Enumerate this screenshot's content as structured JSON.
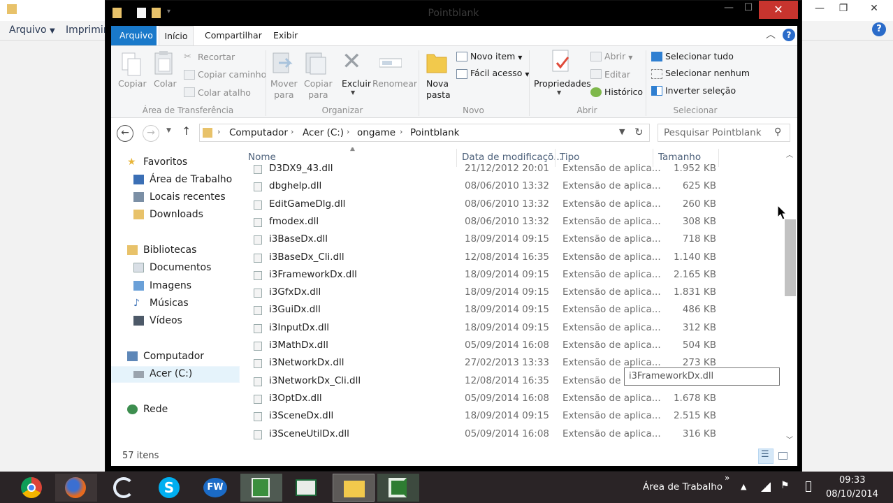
{
  "background_window": {
    "menu": [
      "Arquivo",
      "Imprimir"
    ],
    "controls": [
      "—",
      "❐",
      "✕"
    ]
  },
  "window": {
    "title": "Pointblank",
    "controls": {
      "minimize": "—",
      "maximize": "☐",
      "close": "✕"
    }
  },
  "ribbon_tabs": [
    "Arquivo",
    "Início",
    "Compartilhar",
    "Exibir"
  ],
  "ribbon": {
    "clipboard": {
      "copy": "Copiar",
      "paste": "Colar",
      "cut": "Recortar",
      "copy_path": "Copiar caminho",
      "paste_shortcut": "Colar atalho",
      "group_label": "Área de Transferência"
    },
    "organize": {
      "move_to": [
        "Mover",
        "para"
      ],
      "copy_to": [
        "Copiar",
        "para"
      ],
      "delete": "Excluir",
      "rename": "Renomear",
      "group_label": "Organizar"
    },
    "new": {
      "new_folder": [
        "Nova",
        "pasta"
      ],
      "new_item": "Novo item",
      "easy_access": "Fácil acesso",
      "group_label": "Novo"
    },
    "open": {
      "properties": "Propriedades",
      "open": "Abrir",
      "edit": "Editar",
      "history": "Histórico",
      "group_label": "Abrir"
    },
    "select": {
      "select_all": "Selecionar tudo",
      "select_none": "Selecionar nenhum",
      "invert": "Inverter seleção",
      "group_label": "Selecionar"
    }
  },
  "breadcrumb": [
    "Computador",
    "Acer (C:)",
    "ongame",
    "Pointblank"
  ],
  "search": {
    "placeholder": "Pesquisar Pointblank"
  },
  "nav": {
    "favorites": "Favoritos",
    "desktop": "Área de Trabalho",
    "recent": "Locais recentes",
    "downloads": "Downloads",
    "libraries": "Bibliotecas",
    "documents": "Documentos",
    "images": "Imagens",
    "music": "Músicas",
    "videos": "Vídeos",
    "computer": "Computador",
    "drive": "Acer (C:)",
    "network": "Rede"
  },
  "columns": {
    "name": "Nome",
    "date": "Data de modificaçõ...",
    "type": "Tipo",
    "size": "Tamanho"
  },
  "files": [
    {
      "name": "D3DX9_43.dll",
      "date": "21/12/2012 20:01",
      "type": "Extensão de aplica...",
      "size": "1.952 KB"
    },
    {
      "name": "dbghelp.dll",
      "date": "08/06/2010 13:32",
      "type": "Extensão de aplica...",
      "size": "625 KB"
    },
    {
      "name": "EditGameDlg.dll",
      "date": "08/06/2010 13:32",
      "type": "Extensão de aplica...",
      "size": "260 KB"
    },
    {
      "name": "fmodex.dll",
      "date": "08/06/2010 13:32",
      "type": "Extensão de aplica...",
      "size": "308 KB"
    },
    {
      "name": "i3BaseDx.dll",
      "date": "18/09/2014 09:15",
      "type": "Extensão de aplica...",
      "size": "718 KB"
    },
    {
      "name": "i3BaseDx_Cli.dll",
      "date": "12/08/2014 16:35",
      "type": "Extensão de aplica...",
      "size": "1.140 KB"
    },
    {
      "name": "i3FrameworkDx.dll",
      "date": "18/09/2014 09:15",
      "type": "Extensão de aplica...",
      "size": "2.165 KB"
    },
    {
      "name": "i3GfxDx.dll",
      "date": "18/09/2014 09:15",
      "type": "Extensão de aplica...",
      "size": "1.831 KB"
    },
    {
      "name": "i3GuiDx.dll",
      "date": "18/09/2014 09:15",
      "type": "Extensão de aplica...",
      "size": "486 KB"
    },
    {
      "name": "i3InputDx.dll",
      "date": "18/09/2014 09:15",
      "type": "Extensão de aplica...",
      "size": "312 KB"
    },
    {
      "name": "i3MathDx.dll",
      "date": "05/09/2014 16:08",
      "type": "Extensão de aplica...",
      "size": "504 KB"
    },
    {
      "name": "i3NetworkDx.dll",
      "date": "27/02/2013 13:33",
      "type": "Extensão de aplica...",
      "size": "273 KB"
    },
    {
      "name": "i3NetworkDx_Cli.dll",
      "date": "12/08/2014 16:35",
      "type": "Extensão de a",
      "size": ""
    },
    {
      "name": "i3OptDx.dll",
      "date": "05/09/2014 16:08",
      "type": "Extensão de aplica...",
      "size": "1.678 KB"
    },
    {
      "name": "i3SceneDx.dll",
      "date": "18/09/2014 09:15",
      "type": "Extensão de aplica...",
      "size": "2.515 KB"
    },
    {
      "name": "i3SceneUtilDx.dll",
      "date": "05/09/2014 16:08",
      "type": "Extensão de aplica...",
      "size": "316 KB"
    }
  ],
  "tooltip": "i3FrameworkDx.dll",
  "status": {
    "count": "57 itens"
  },
  "taskbar": {
    "tray_label": "Área de Trabalho",
    "chevron": "»",
    "time": "09:33",
    "date": "08/10/2014"
  },
  "colors": {
    "accent": "#1979ca",
    "close": "#c7342e",
    "taskbar": "#2a2426"
  }
}
